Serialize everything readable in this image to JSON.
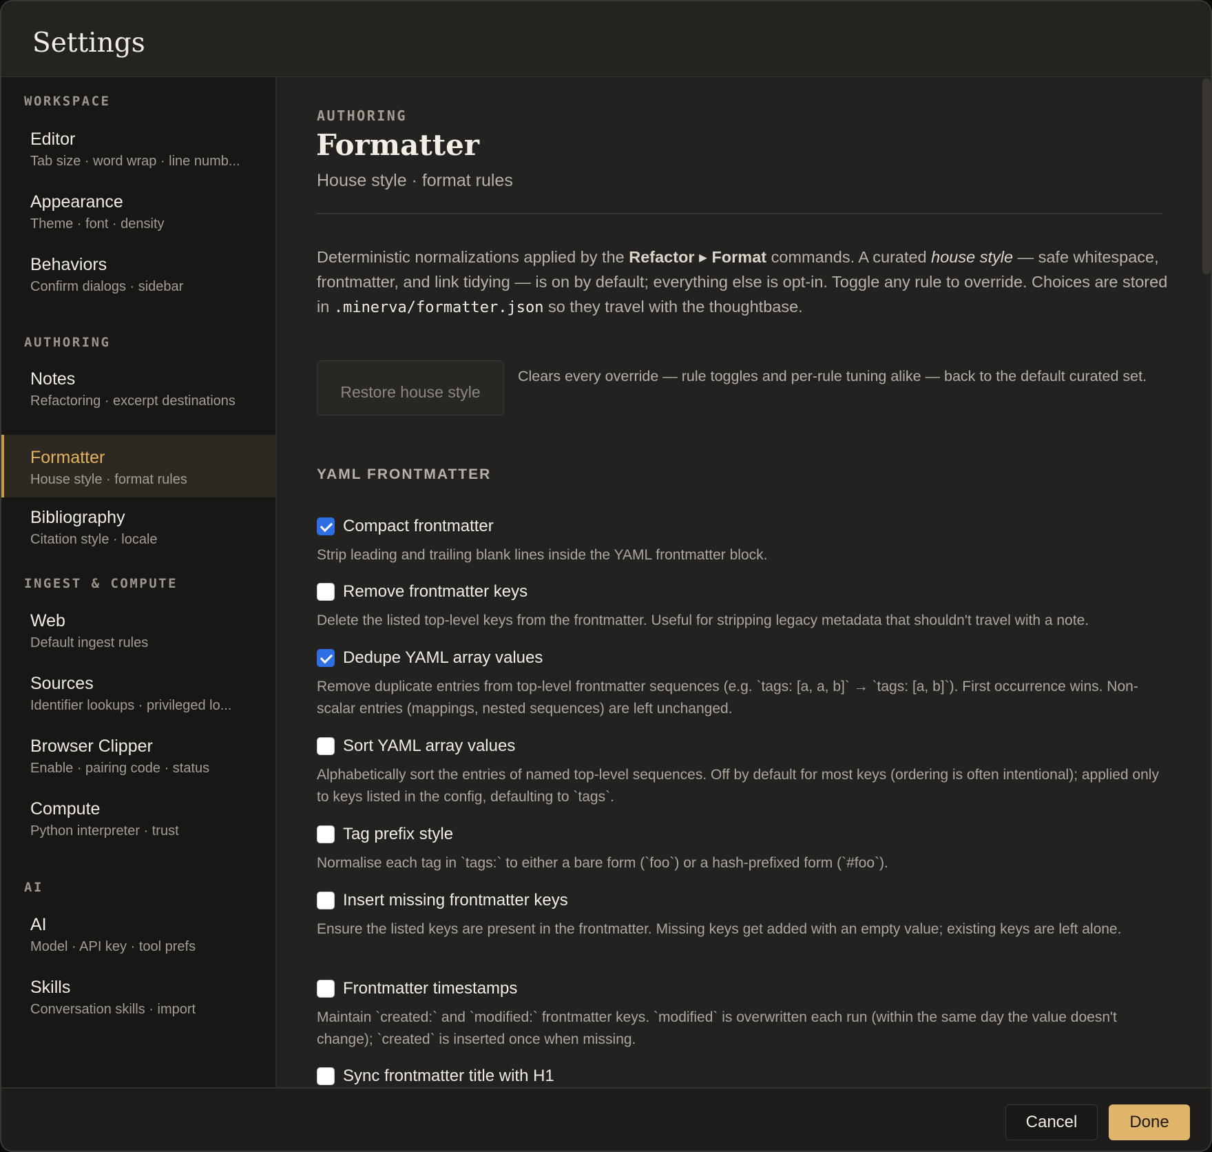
{
  "dialog": {
    "title": "Settings",
    "cancel_label": "Cancel",
    "done_label": "Done"
  },
  "sidebar": {
    "sections": [
      {
        "label": "WORKSPACE"
      },
      {
        "label": "AUTHORING"
      },
      {
        "label": "INGEST & COMPUTE"
      },
      {
        "label": "AI"
      }
    ],
    "items": [
      {
        "title": "Editor",
        "subtitle": "Tab size · word wrap · line numb..."
      },
      {
        "title": "Appearance",
        "subtitle": "Theme · font · density"
      },
      {
        "title": "Behaviors",
        "subtitle": "Confirm dialogs · sidebar"
      },
      {
        "title": "Notes",
        "subtitle": "Refactoring · excerpt destinations"
      },
      {
        "title": "Formatter",
        "subtitle": "House style · format rules",
        "active": true
      },
      {
        "title": "Bibliography",
        "subtitle": "Citation style · locale"
      },
      {
        "title": "Web",
        "subtitle": "Default ingest rules"
      },
      {
        "title": "Sources",
        "subtitle": "Identifier lookups · privileged lo..."
      },
      {
        "title": "Browser Clipper",
        "subtitle": "Enable · pairing code · status"
      },
      {
        "title": "Compute",
        "subtitle": "Python interpreter · trust"
      },
      {
        "title": "AI",
        "subtitle": "Model · API key · tool prefs"
      },
      {
        "title": "Skills",
        "subtitle": "Conversation skills · import"
      }
    ]
  },
  "main": {
    "eyebrow": "AUTHORING",
    "title": "Formatter",
    "subtitle": "House style · format rules",
    "intro": {
      "p1": "Deterministic normalizations applied by the ",
      "bold1": "Refactor",
      "arrow": " ▸ ",
      "bold2": "Format",
      "p2": " commands. A curated ",
      "italic": "house style",
      "p3": " — safe whitespace, frontmatter, and link tidying — is on by default; everything else is opt-in. Toggle any rule to override. Choices are stored in ",
      "code": ".minerva/formatter.json",
      "p4": " so they travel with the thoughtbase."
    },
    "restore_label": "Restore house style",
    "restore_desc": "Clears every override — rule toggles and per-rule tuning alike — back to the default curated set.",
    "group_label": "YAML FRONTMATTER",
    "rules": [
      {
        "title": "Compact frontmatter",
        "checked": true,
        "desc": "Strip leading and trailing blank lines inside the YAML frontmatter block."
      },
      {
        "title": "Remove frontmatter keys",
        "checked": false,
        "desc": "Delete the listed top-level keys from the frontmatter. Useful for stripping legacy metadata that shouldn't travel with a note."
      },
      {
        "title": "Dedupe YAML array values",
        "checked": true,
        "desc": "Remove duplicate entries from top-level frontmatter sequences (e.g. `tags: [a, a, b]` → `tags: [a, b]`). First occurrence wins. Non-scalar entries (mappings, nested sequences) are left unchanged."
      },
      {
        "title": "Sort YAML array values",
        "checked": false,
        "desc": "Alphabetically sort the entries of named top-level sequences. Off by default for most keys (ordering is often intentional); applied only to keys listed in the config, defaulting to `tags`."
      },
      {
        "title": "Tag prefix style",
        "checked": false,
        "desc": "Normalise each tag in `tags:` to either a bare form (`foo`) or a hash-prefixed form (`#foo`)."
      },
      {
        "title": "Insert missing frontmatter keys",
        "checked": false,
        "desc": "Ensure the listed keys are present in the frontmatter. Missing keys get added with an empty value; existing keys are left alone."
      },
      {
        "title": "Frontmatter timestamps",
        "checked": false,
        "desc": "Maintain `created:` and `modified:` frontmatter keys. `modified` is overwritten each run (within the same day the value doesn't change); `created` is inserted once when missing."
      },
      {
        "title": "Sync frontmatter title with H1",
        "checked": false,
        "desc": ""
      }
    ]
  }
}
